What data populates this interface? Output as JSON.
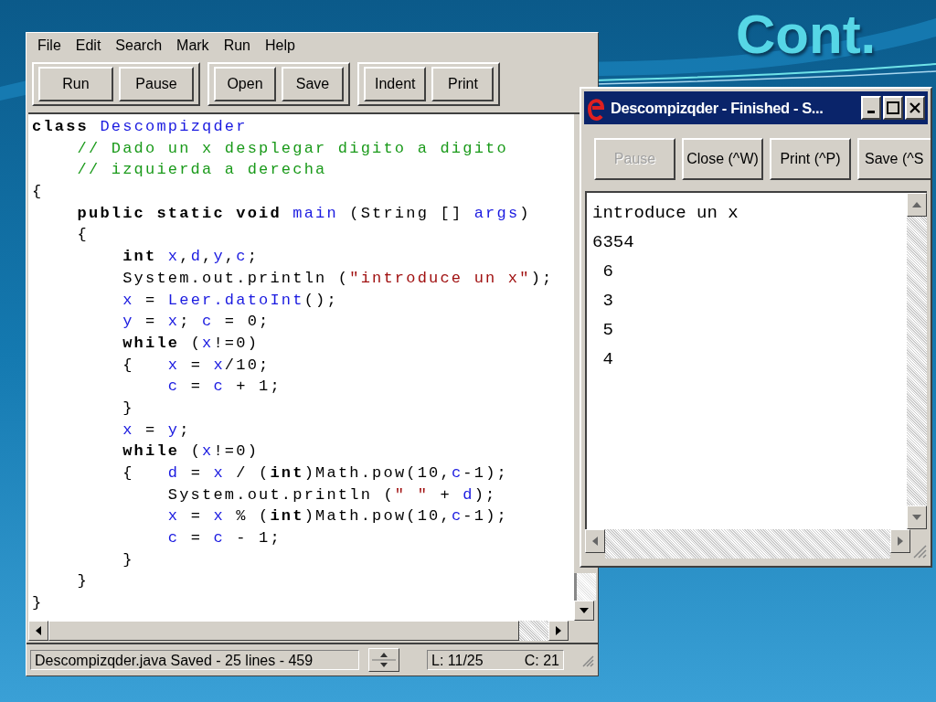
{
  "slide": {
    "title": "Cont."
  },
  "editor": {
    "menu": [
      "File",
      "Edit",
      "Search",
      "Mark",
      "Run",
      "Help"
    ],
    "toolbar": [
      {
        "buttons": [
          "Run",
          "Pause"
        ]
      },
      {
        "buttons": [
          "Open",
          "Save"
        ]
      },
      {
        "buttons": [
          "Indent",
          "Print"
        ]
      }
    ],
    "code": [
      [
        {
          "kind": "kw",
          "text": "class "
        },
        {
          "kind": "id",
          "text": "Descompizqder"
        }
      ],
      [
        {
          "kind": "com",
          "text": "    // Dado un x desplegar digito a digito"
        }
      ],
      [
        {
          "kind": "com",
          "text": "    // izquierda a derecha"
        }
      ],
      [
        {
          "kind": "plain",
          "text": "{"
        }
      ],
      [
        {
          "kind": "kw",
          "text": "    public static void "
        },
        {
          "kind": "id",
          "text": "main"
        },
        {
          "kind": "plain",
          "text": " (String [] "
        },
        {
          "kind": "id",
          "text": "args"
        },
        {
          "kind": "plain",
          "text": ")"
        }
      ],
      [
        {
          "kind": "plain",
          "text": "    {"
        }
      ],
      [
        {
          "kind": "kw",
          "text": "        int "
        },
        {
          "kind": "id",
          "text": "x"
        },
        {
          "kind": "plain",
          "text": ","
        },
        {
          "kind": "id",
          "text": "d"
        },
        {
          "kind": "plain",
          "text": ","
        },
        {
          "kind": "id",
          "text": "y"
        },
        {
          "kind": "plain",
          "text": ","
        },
        {
          "kind": "id",
          "text": "c"
        },
        {
          "kind": "plain",
          "text": ";"
        }
      ],
      [
        {
          "kind": "plain",
          "text": "        System.out.println ("
        },
        {
          "kind": "str",
          "text": "\"introduce un x\""
        },
        {
          "kind": "plain",
          "text": ");"
        }
      ],
      [
        {
          "kind": "id",
          "text": "        x"
        },
        {
          "kind": "plain",
          "text": " = "
        },
        {
          "kind": "id",
          "text": "Leer.datoInt"
        },
        {
          "kind": "plain",
          "text": "();"
        }
      ],
      [
        {
          "kind": "id",
          "text": "        y"
        },
        {
          "kind": "plain",
          "text": " = "
        },
        {
          "kind": "id",
          "text": "x"
        },
        {
          "kind": "plain",
          "text": "; "
        },
        {
          "kind": "id",
          "text": "c"
        },
        {
          "kind": "plain",
          "text": " = 0;"
        }
      ],
      [
        {
          "kind": "kw",
          "text": "        while"
        },
        {
          "kind": "plain",
          "text": " ("
        },
        {
          "kind": "id",
          "text": "x"
        },
        {
          "kind": "plain",
          "text": "!=0)"
        }
      ],
      [
        {
          "kind": "plain",
          "text": "        {   "
        },
        {
          "kind": "id",
          "text": "x"
        },
        {
          "kind": "plain",
          "text": " = "
        },
        {
          "kind": "id",
          "text": "x"
        },
        {
          "kind": "plain",
          "text": "/10;"
        }
      ],
      [
        {
          "kind": "id",
          "text": "            c"
        },
        {
          "kind": "plain",
          "text": " = "
        },
        {
          "kind": "id",
          "text": "c"
        },
        {
          "kind": "plain",
          "text": " + 1;"
        }
      ],
      [
        {
          "kind": "plain",
          "text": "        }"
        }
      ],
      [
        {
          "kind": "id",
          "text": "        x"
        },
        {
          "kind": "plain",
          "text": " = "
        },
        {
          "kind": "id",
          "text": "y"
        },
        {
          "kind": "plain",
          "text": ";"
        }
      ],
      [
        {
          "kind": "kw",
          "text": "        while"
        },
        {
          "kind": "plain",
          "text": " ("
        },
        {
          "kind": "id",
          "text": "x"
        },
        {
          "kind": "plain",
          "text": "!=0)"
        }
      ],
      [
        {
          "kind": "plain",
          "text": "        {   "
        },
        {
          "kind": "id",
          "text": "d"
        },
        {
          "kind": "plain",
          "text": " = "
        },
        {
          "kind": "id",
          "text": "x"
        },
        {
          "kind": "plain",
          "text": " / ("
        },
        {
          "kind": "kw",
          "text": "int"
        },
        {
          "kind": "plain",
          "text": ")Math.pow(10,"
        },
        {
          "kind": "id",
          "text": "c"
        },
        {
          "kind": "plain",
          "text": "-1);"
        }
      ],
      [
        {
          "kind": "plain",
          "text": "            System.out.println ("
        },
        {
          "kind": "str",
          "text": "\" \""
        },
        {
          "kind": "plain",
          "text": " + "
        },
        {
          "kind": "id",
          "text": "d"
        },
        {
          "kind": "plain",
          "text": ");"
        }
      ],
      [
        {
          "kind": "id",
          "text": "            x"
        },
        {
          "kind": "plain",
          "text": " = "
        },
        {
          "kind": "id",
          "text": "x"
        },
        {
          "kind": "plain",
          "text": " % ("
        },
        {
          "kind": "kw",
          "text": "int"
        },
        {
          "kind": "plain",
          "text": ")Math.pow(10,"
        },
        {
          "kind": "id",
          "text": "c"
        },
        {
          "kind": "plain",
          "text": "-1);"
        }
      ],
      [
        {
          "kind": "id",
          "text": "            c"
        },
        {
          "kind": "plain",
          "text": " = "
        },
        {
          "kind": "id",
          "text": "c"
        },
        {
          "kind": "plain",
          "text": " - 1;"
        }
      ],
      [
        {
          "kind": "plain",
          "text": "        }"
        }
      ],
      [
        {
          "kind": "plain",
          "text": "    }"
        }
      ],
      [
        {
          "kind": "plain",
          "text": "}"
        }
      ]
    ],
    "status": {
      "message": "Descompizqder.java Saved - 25 lines - 459",
      "line": "L: 11/25",
      "column": "C: 21"
    }
  },
  "output_window": {
    "title": "Descompizqder - Finished  - S...",
    "buttons": [
      {
        "label": "Pause",
        "disabled": true
      },
      {
        "label": "Close (^W)",
        "disabled": false
      },
      {
        "label": "Print (^P)",
        "disabled": false
      },
      {
        "label": "Save (^S",
        "disabled": false
      }
    ],
    "lines": [
      "introduce un x",
      "6354",
      " 6",
      " 3",
      " 5",
      " 4"
    ]
  }
}
